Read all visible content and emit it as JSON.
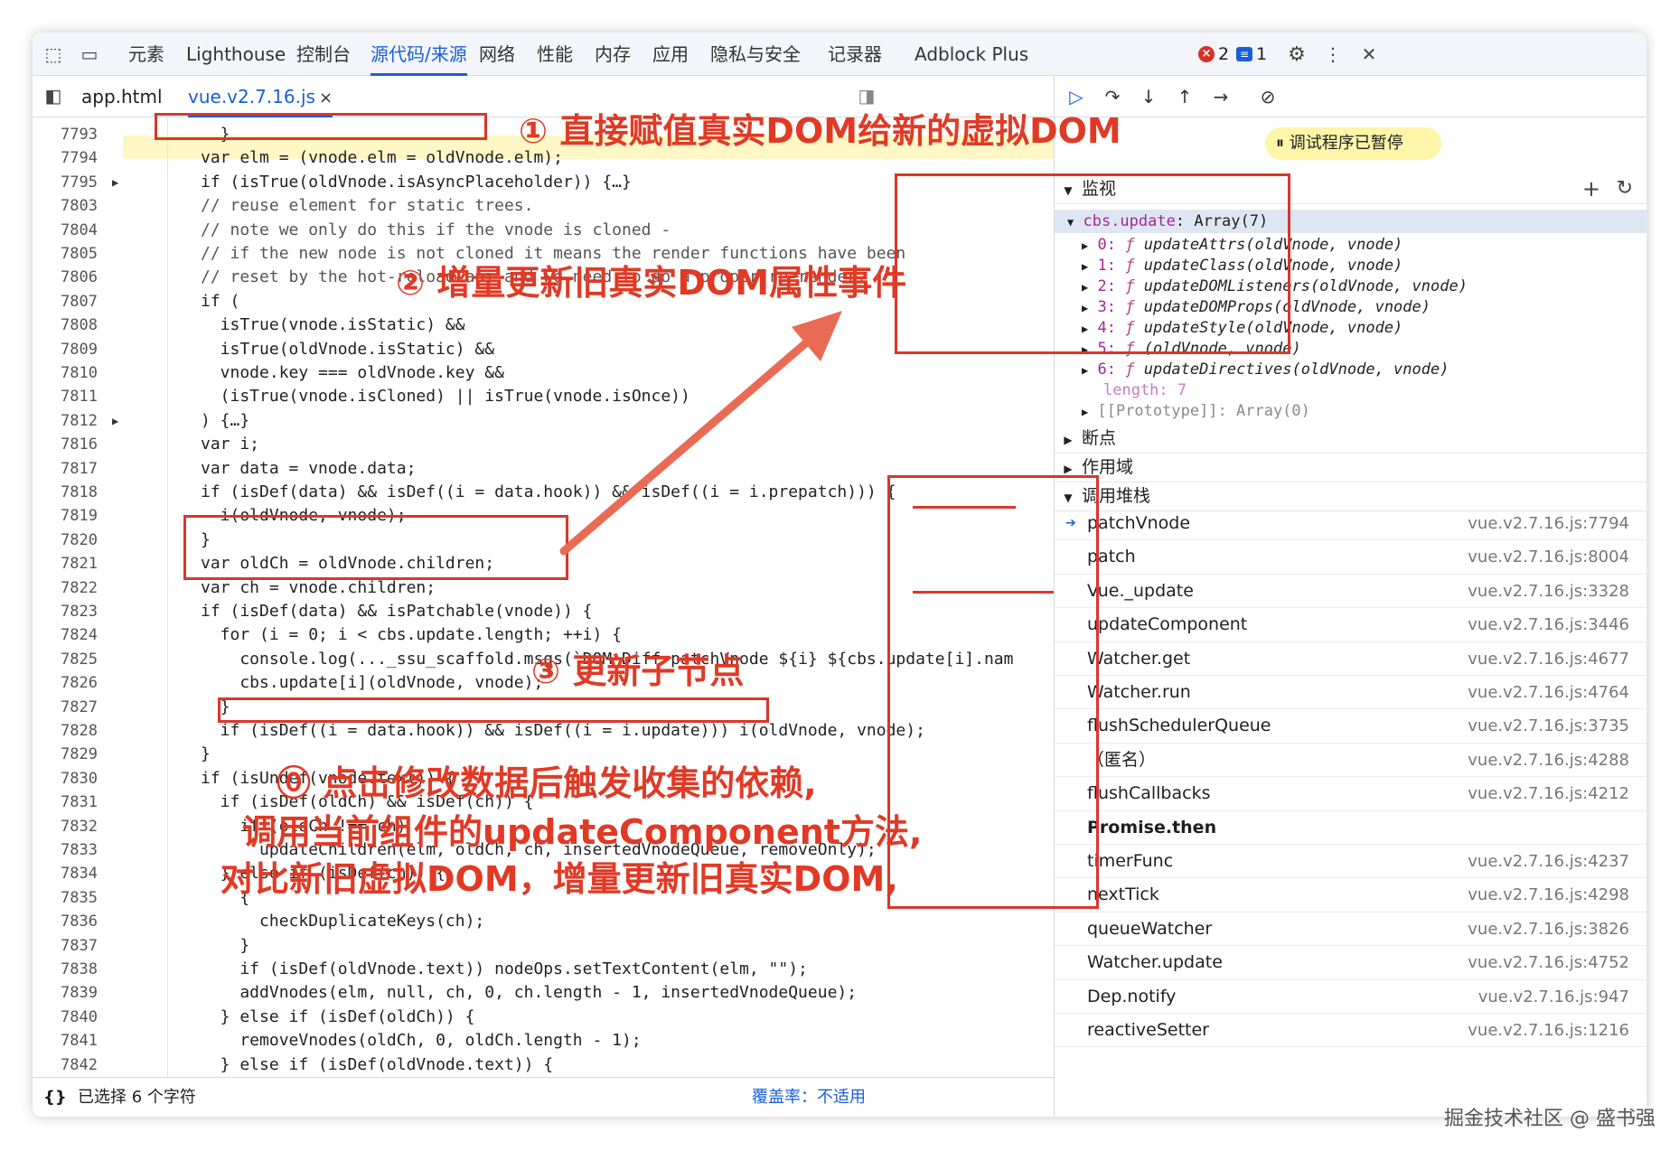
{
  "toolbar": {
    "tabs": [
      "元素",
      "Lighthouse",
      "控制台",
      "源代码/来源",
      "网络",
      "性能",
      "内存",
      "应用",
      "隐私与安全",
      "记录器",
      "Adblock Plus"
    ],
    "error_count": "2",
    "message_count": "1"
  },
  "files": {
    "tab1": "app.html",
    "tab2": "vue.v2.7.16.js",
    "close": "×"
  },
  "code_lines": [
    {
      "n": "7793",
      "t": "  }"
    },
    {
      "n": "7794",
      "t": "var elm = (vnode.elm = oldVnode.elm);"
    },
    {
      "n": "7795",
      "t": "if (isTrue(oldVnode.isAsyncPlaceholder)) {…}"
    },
    {
      "n": "7803",
      "t": "// reuse element for static trees."
    },
    {
      "n": "7804",
      "t": "// note we only do this if the vnode is cloned -"
    },
    {
      "n": "7805",
      "t": "// if the new node is not cloned it means the render functions have been"
    },
    {
      "n": "7806",
      "t": "// reset by the hot-reload-api and we need to do a proper re-render."
    },
    {
      "n": "7807",
      "t": "if ("
    },
    {
      "n": "7808",
      "t": "  isTrue(vnode.isStatic) &&"
    },
    {
      "n": "7809",
      "t": "  isTrue(oldVnode.isStatic) &&"
    },
    {
      "n": "7810",
      "t": "  vnode.key === oldVnode.key &&"
    },
    {
      "n": "7811",
      "t": "  (isTrue(vnode.isCloned) || isTrue(vnode.isOnce))"
    },
    {
      "n": "7812",
      "t": ") {…}"
    },
    {
      "n": "7816",
      "t": "var i;"
    },
    {
      "n": "7817",
      "t": "var data = vnode.data;"
    },
    {
      "n": "7818",
      "t": "if (isDef(data) && isDef((i = data.hook)) && isDef((i = i.prepatch))) {"
    },
    {
      "n": "7819",
      "t": "  i(oldVnode, vnode);"
    },
    {
      "n": "7820",
      "t": "}"
    },
    {
      "n": "7821",
      "t": "var oldCh = oldVnode.children;"
    },
    {
      "n": "7822",
      "t": "var ch = vnode.children;"
    },
    {
      "n": "7823",
      "t": "if (isDef(data) && isPatchable(vnode)) {"
    },
    {
      "n": "7824",
      "t": "  for (i = 0; i < cbs.update.length; ++i) {"
    },
    {
      "n": "7825",
      "t": "    console.log(..._ssu_scaffold.msgs(`DOM Diff patchVnode ${i} ${cbs.update[i].nam"
    },
    {
      "n": "7826",
      "t": "    cbs.update[i](oldVnode, vnode);"
    },
    {
      "n": "7827",
      "t": "  }"
    },
    {
      "n": "7828",
      "t": "  if (isDef((i = data.hook)) && isDef((i = i.update))) i(oldVnode, vnode);"
    },
    {
      "n": "7829",
      "t": "}"
    },
    {
      "n": "7830",
      "t": "if (isUndef(vnode.text)) {"
    },
    {
      "n": "7831",
      "t": "  if (isDef(oldCh) && isDef(ch)) {"
    },
    {
      "n": "7832",
      "t": "    if (oldCh !== ch)"
    },
    {
      "n": "7833",
      "t": "      updateChildren(elm, oldCh, ch, insertedVnodeQueue, removeOnly);"
    },
    {
      "n": "7834",
      "t": "  } else if (isDef(ch)) {"
    },
    {
      "n": "7835",
      "t": "    {"
    },
    {
      "n": "7836",
      "t": "      checkDuplicateKeys(ch);"
    },
    {
      "n": "7837",
      "t": "    }"
    },
    {
      "n": "7838",
      "t": "    if (isDef(oldVnode.text)) nodeOps.setTextContent(elm, \"\");"
    },
    {
      "n": "7839",
      "t": "    addVnodes(elm, null, ch, 0, ch.length - 1, insertedVnodeQueue);"
    },
    {
      "n": "7840",
      "t": "  } else if (isDef(oldCh)) {"
    },
    {
      "n": "7841",
      "t": "    removeVnodes(oldCh, 0, oldCh.length - 1);"
    },
    {
      "n": "7842",
      "t": "  } else if (isDef(oldVnode.text)) {"
    }
  ],
  "debugger": {
    "paused": "调试程序已暂停",
    "watch": "监视",
    "breakpoints": "断点",
    "scope": "作用域",
    "callstack": "调用堆栈"
  },
  "watch": {
    "expr": "cbs.update",
    "type": "Array(7)",
    "items": [
      {
        "k": "0:",
        "v": "updateAttrs(oldVnode, vnode)"
      },
      {
        "k": "1:",
        "v": "updateClass(oldVnode, vnode)"
      },
      {
        "k": "2:",
        "v": "updateDOMListeners(oldVnode, vnode)"
      },
      {
        "k": "3:",
        "v": "updateDOMProps(oldVnode, vnode)"
      },
      {
        "k": "4:",
        "v": "updateStyle(oldVnode, vnode)"
      },
      {
        "k": "5:",
        "v": "(oldVnode, vnode)"
      },
      {
        "k": "6:",
        "v": "updateDirectives(oldVnode, vnode)"
      }
    ],
    "fglyph": "ƒ",
    "length": "length: 7",
    "proto": "[[Prototype]]: Array(0)"
  },
  "callstack": [
    {
      "fn": "patchVnode",
      "loc": "vue.v2.7.16.js:7794"
    },
    {
      "fn": "patch",
      "loc": "vue.v2.7.16.js:8004"
    },
    {
      "fn": "Vue._update",
      "loc": "vue.v2.7.16.js:3328"
    },
    {
      "fn": "updateComponent",
      "loc": "vue.v2.7.16.js:3446"
    },
    {
      "fn": "Watcher.get",
      "loc": "vue.v2.7.16.js:4677"
    },
    {
      "fn": "Watcher.run",
      "loc": "vue.v2.7.16.js:4764"
    },
    {
      "fn": "flushSchedulerQueue",
      "loc": "vue.v2.7.16.js:3735"
    },
    {
      "fn": "（匿名）",
      "loc": "vue.v2.7.16.js:4288"
    },
    {
      "fn": "flushCallbacks",
      "loc": "vue.v2.7.16.js:4212"
    },
    {
      "fn": "Promise.then",
      "loc": ""
    },
    {
      "fn": "timerFunc",
      "loc": "vue.v2.7.16.js:4237"
    },
    {
      "fn": "nextTick",
      "loc": "vue.v2.7.16.js:4298"
    },
    {
      "fn": "queueWatcher",
      "loc": "vue.v2.7.16.js:3826"
    },
    {
      "fn": "Watcher.update",
      "loc": "vue.v2.7.16.js:4752"
    },
    {
      "fn": "Dep.notify",
      "loc": "vue.v2.7.16.js:947"
    },
    {
      "fn": "reactiveSetter",
      "loc": "vue.v2.7.16.js:1216"
    }
  ],
  "status": {
    "braces": "{}",
    "selected": "已选择 6 个字符",
    "coverage": "覆盖率：不适用"
  },
  "annotations": {
    "a1": "① 直接赋值真实DOM给新的虚拟DOM",
    "a2": "② 增量更新旧真实DOM属性事件",
    "a3": "③ 更新子节点",
    "a0_l1": "⓪ 点击修改数据后触发收集的依赖,",
    "a0_l2": "调用当前组件的updateComponent方法,",
    "a0_l3": "对比新旧虚拟DOM，增量更新旧真实DOM,"
  },
  "watermark": "掘金技术社区 @ 盛书强",
  "colors": {
    "accent": "#1a5fd6",
    "annotation": "#e03a26",
    "pause_highlight": "#fdf5a7"
  }
}
